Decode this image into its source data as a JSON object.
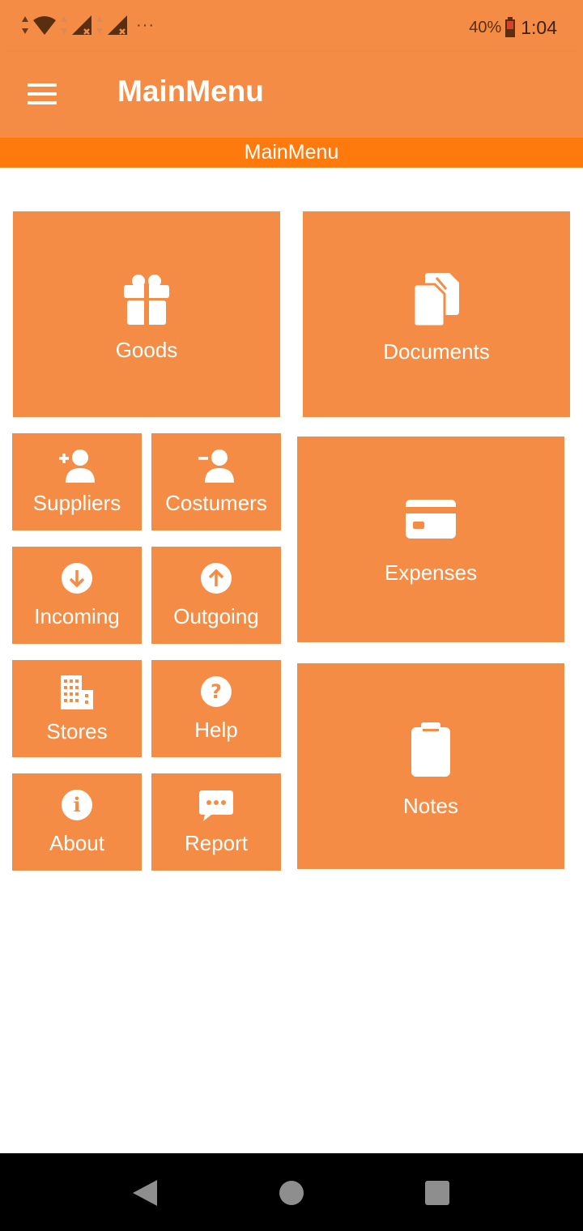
{
  "status_bar": {
    "battery_percent": "40%",
    "time": "1:04",
    "overflow": "···"
  },
  "app_bar": {
    "title": "MainMenu",
    "menu_icon": "hamburger-menu-icon"
  },
  "sub_header": {
    "title": "MainMenu"
  },
  "tiles": {
    "goods": {
      "label": "Goods",
      "icon": "gift-icon"
    },
    "documents": {
      "label": "Documents",
      "icon": "documents-icon"
    },
    "suppliers": {
      "label": "Suppliers",
      "icon": "user-plus-icon"
    },
    "costumers": {
      "label": "Costumers",
      "icon": "user-minus-icon"
    },
    "incoming": {
      "label": "Incoming",
      "icon": "arrow-down-circle-icon"
    },
    "outgoing": {
      "label": "Outgoing",
      "icon": "arrow-up-circle-icon"
    },
    "stores": {
      "label": "Stores",
      "icon": "building-icon"
    },
    "help": {
      "label": "Help",
      "icon": "question-circle-icon"
    },
    "about": {
      "label": "About",
      "icon": "info-circle-icon"
    },
    "report": {
      "label": "Report",
      "icon": "chat-bubble-icon"
    },
    "expenses": {
      "label": "Expenses",
      "icon": "credit-card-icon"
    },
    "notes": {
      "label": "Notes",
      "icon": "clipboard-icon"
    }
  },
  "nav_bar": {
    "back": "back-triangle-icon",
    "home": "home-circle-icon",
    "recents": "recents-square-icon"
  },
  "colors": {
    "tile": "#f48c45",
    "app_bar": "#f48c45",
    "sub_header": "#ff7a0c",
    "nav_bar": "#000000"
  }
}
